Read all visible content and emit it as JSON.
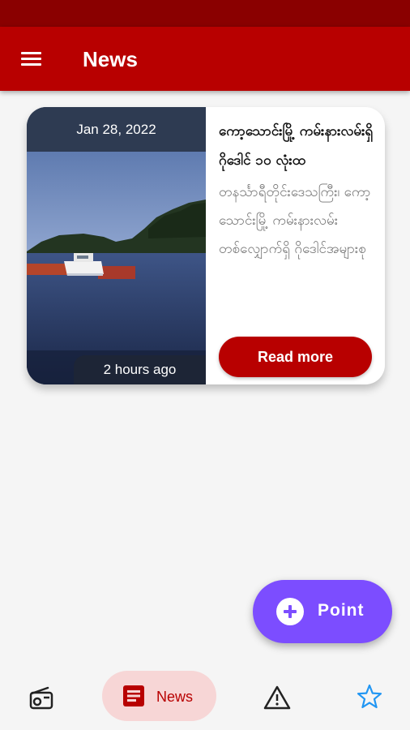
{
  "app_bar": {
    "title": "News",
    "menu_icon": "menu-icon"
  },
  "news_card": {
    "date": "Jan 28, 2022",
    "time_ago": "2 hours ago",
    "title": "ကော့သောင်းမြို့ ကမ်းနားလမ်းရှိ ဂိုဒေါင် ၁၀ လုံးထ",
    "description": "တနင်္သာရီတိုင်းဒေသကြီး၊ ကော့သောင်းမြို့ ကမ်းနားလမ်းတစ်လျှောက်ရှိ ဂိုဒေါင်အများစု",
    "read_more": "Read more",
    "image": "boat-on-water-image"
  },
  "fab": {
    "label": "Point",
    "icon": "add-circle-icon",
    "color": "#7c4dff"
  },
  "bottom_nav": {
    "items": [
      {
        "icon": "radio-icon",
        "label": ""
      },
      {
        "icon": "article-icon",
        "label": "News",
        "selected": true
      },
      {
        "icon": "warning-icon",
        "label": ""
      },
      {
        "icon": "star-icon",
        "label": ""
      }
    ]
  },
  "colors": {
    "primary": "#b80000",
    "status_bar": "#8a0000",
    "nav_selected_bg": "#f7d6d6",
    "star": "#2196f3"
  }
}
